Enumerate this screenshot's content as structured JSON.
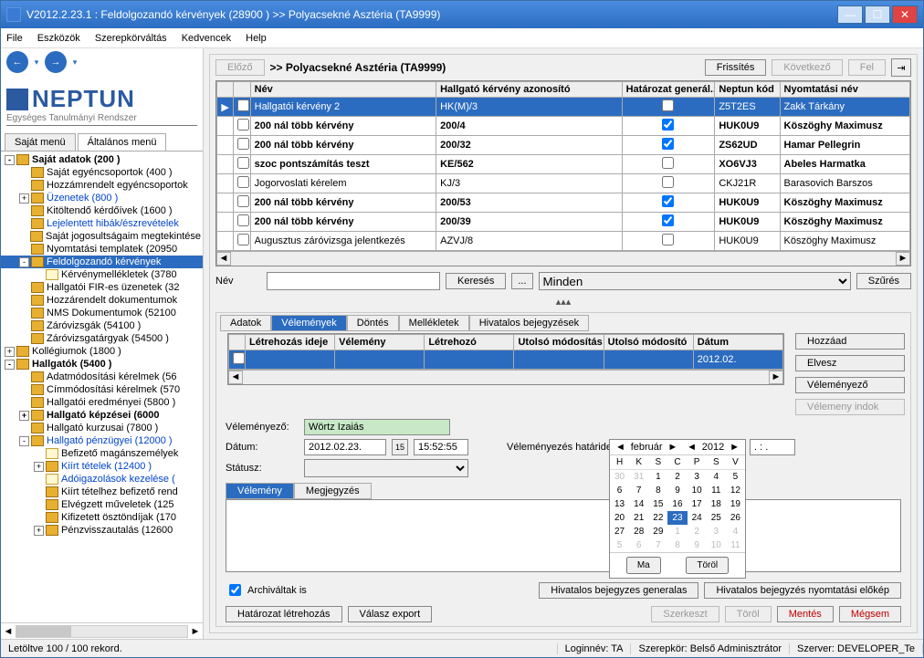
{
  "window": {
    "title": "V2012.2.23.1 : Feldolgozandó kérvények (28900 )  >> Polyacsekné Asztéria (TA9999)"
  },
  "menu": [
    "File",
    "Eszközök",
    "Szerepkörváltás",
    "Kedvencek",
    "Help"
  ],
  "logo": {
    "text": "NEPTUN",
    "sub": "Egységes Tanulmányi Rendszer"
  },
  "sidebarTabs": {
    "a": "Saját menü",
    "b": "Általános menü"
  },
  "tree": [
    {
      "lvl": 0,
      "exp": "-",
      "icon": "f",
      "bold": true,
      "label": "Saját adatok (200  )"
    },
    {
      "lvl": 1,
      "exp": "",
      "icon": "f",
      "label": "Saját egyéncsoportok (400  )"
    },
    {
      "lvl": 1,
      "exp": "",
      "icon": "f",
      "label": "Hozzámrendelt egyéncsoportok"
    },
    {
      "lvl": 1,
      "exp": "+",
      "icon": "f",
      "link": true,
      "label": "Üzenetek (800  )"
    },
    {
      "lvl": 1,
      "exp": "",
      "icon": "f",
      "label": "Kitöltendő kérdőívek (1600  )"
    },
    {
      "lvl": 1,
      "exp": "",
      "icon": "f",
      "link": true,
      "label": "Lejelentett hibák/észrevételek"
    },
    {
      "lvl": 1,
      "exp": "",
      "icon": "f",
      "label": "Saját jogosultságaim megtekintése"
    },
    {
      "lvl": 1,
      "exp": "",
      "icon": "f",
      "label": "Nyomtatási templatek (20950"
    },
    {
      "lvl": 1,
      "exp": "-",
      "icon": "f",
      "link": true,
      "sel": true,
      "label": "Feldolgozandó kérvények"
    },
    {
      "lvl": 2,
      "exp": "",
      "icon": "d",
      "label": "Kérvénymellékletek (3780"
    },
    {
      "lvl": 1,
      "exp": "",
      "icon": "f",
      "label": "Hallgatói FIR-es üzenetek (32"
    },
    {
      "lvl": 1,
      "exp": "",
      "icon": "f",
      "label": "Hozzárendelt dokumentumok"
    },
    {
      "lvl": 1,
      "exp": "",
      "icon": "f",
      "label": "NMS Dokumentumok (52100"
    },
    {
      "lvl": 1,
      "exp": "",
      "icon": "f",
      "label": "Záróvizsgák (54100  )"
    },
    {
      "lvl": 1,
      "exp": "",
      "icon": "f",
      "label": "Záróvizsgatárgyak (54500  )"
    },
    {
      "lvl": 0,
      "exp": "+",
      "icon": "f",
      "label": "Kollégiumok (1800  )"
    },
    {
      "lvl": 0,
      "exp": "-",
      "icon": "f",
      "bold": true,
      "label": "Hallgatók (5400  )"
    },
    {
      "lvl": 1,
      "exp": "",
      "icon": "f",
      "label": "Adatmódosítási kérelmek (56"
    },
    {
      "lvl": 1,
      "exp": "",
      "icon": "f",
      "label": "Címmódosítási kérelmek (570"
    },
    {
      "lvl": 1,
      "exp": "",
      "icon": "f",
      "label": "Hallgatói eredményei (5800  )"
    },
    {
      "lvl": 1,
      "exp": "+",
      "icon": "f",
      "bold": true,
      "label": "Hallgató képzései (6000"
    },
    {
      "lvl": 1,
      "exp": "",
      "icon": "f",
      "label": "Hallgató kurzusai (7800  )"
    },
    {
      "lvl": 1,
      "exp": "-",
      "icon": "f",
      "link": true,
      "label": "Hallgató pénzügyei (12000  )"
    },
    {
      "lvl": 2,
      "exp": "",
      "icon": "d",
      "label": "Befizető magánszemélyek"
    },
    {
      "lvl": 2,
      "exp": "+",
      "icon": "f",
      "link": true,
      "label": "Kiírt tételek (12400  )"
    },
    {
      "lvl": 2,
      "exp": "",
      "icon": "d",
      "link": true,
      "label": "Adóigazolások kezelése ("
    },
    {
      "lvl": 2,
      "exp": "",
      "icon": "f",
      "label": "Kiírt tételhez befizető rend"
    },
    {
      "lvl": 2,
      "exp": "",
      "icon": "f",
      "label": "Elvégzett műveletek (125"
    },
    {
      "lvl": 2,
      "exp": "",
      "icon": "f",
      "label": "Kifizetett ösztöndíjak (170"
    },
    {
      "lvl": 2,
      "exp": "+",
      "icon": "f",
      "label": "Pénzvisszautalás (12600"
    }
  ],
  "header": {
    "prev": "Előző",
    "title": ">> Polyacsekné Asztéria (TA9999)",
    "refresh": "Frissítés",
    "next": "Következő",
    "up": "Fel"
  },
  "grid": {
    "cols": [
      "Név",
      "Hallgató kérvény azonosító",
      "Határozat generál...",
      "Neptun kód",
      "Nyomtatási név"
    ],
    "rows": [
      {
        "sel": true,
        "bold": false,
        "name": "Hallgatói kérvény 2",
        "id": "HK(M)/3",
        "chk": false,
        "code": "Z5T2ES",
        "pname": "Zakk Tárkány"
      },
      {
        "bold": true,
        "name": "200 nál több kérvény",
        "id": "200/4",
        "chk": true,
        "code": "HUK0U9",
        "pname": "Köszöghy Maximusz"
      },
      {
        "bold": true,
        "name": "200 nál több kérvény",
        "id": "200/32",
        "chk": true,
        "code": "ZS62UD",
        "pname": "Hamar Pellegrin"
      },
      {
        "bold": true,
        "name": "szoc pontszámítás teszt",
        "id": "KE/562",
        "chk": false,
        "code": "XO6VJ3",
        "pname": "Abeles Harmatka"
      },
      {
        "bold": false,
        "name": "Jogorvoslati kérelem",
        "id": "KJ/3",
        "chk": false,
        "code": "CKJ21R",
        "pname": "Barasovich Barszos"
      },
      {
        "bold": true,
        "name": "200 nál több kérvény",
        "id": "200/53",
        "chk": true,
        "code": "HUK0U9",
        "pname": "Köszöghy Maximusz"
      },
      {
        "bold": true,
        "name": "200 nál több kérvény",
        "id": "200/39",
        "chk": true,
        "code": "HUK0U9",
        "pname": "Köszöghy Maximusz"
      },
      {
        "bold": false,
        "name": "Augusztus záróvizsga jelentkezés",
        "id": "AZVJ/8",
        "chk": false,
        "code": "HUK0U9",
        "pname": "Köszöghy Maximusz"
      }
    ]
  },
  "search": {
    "label": "Név",
    "btn": "Keresés",
    "dots": "...",
    "all": "Minden",
    "filter": "Szűrés"
  },
  "sub": {
    "tabs": [
      "Adatok",
      "Vélemények",
      "Döntés",
      "Mellékletek",
      "Hivatalos bejegyzések"
    ],
    "active": 1,
    "cols": [
      "Létrehozás ideje",
      "Vélemény",
      "Létrehozó",
      "Utolsó módosítás ...",
      "Utolsó módosító",
      "Dátum"
    ],
    "rowDate": "2012.02.",
    "sidebtns": [
      "Hozzáad",
      "Elvesz",
      "Véleményező",
      "Vélemeny indok"
    ],
    "fields": {
      "reviewerLbl": "Véleményező:",
      "reviewer": "Wörtz Izaiás",
      "dateLbl": "Dátum:",
      "date": "2012.02.23.",
      "time": "15:52:55",
      "deadlineLbl": "Véleményezés határideje:",
      "deadline": "2012.02.23.",
      "deadlineTime": ". : .",
      "statusLbl": "Státusz:"
    },
    "innerTabs": [
      "Vélemény",
      "Megjegyzés"
    ]
  },
  "calendar": {
    "month": "február",
    "year": "2012",
    "dh": [
      "H",
      "K",
      "S",
      "C",
      "P",
      "S",
      "V"
    ],
    "days": [
      {
        "d": "30",
        "o": 1
      },
      {
        "d": "31",
        "o": 1
      },
      {
        "d": "1"
      },
      {
        "d": "2"
      },
      {
        "d": "3"
      },
      {
        "d": "4"
      },
      {
        "d": "5"
      },
      {
        "d": "6"
      },
      {
        "d": "7"
      },
      {
        "d": "8"
      },
      {
        "d": "9"
      },
      {
        "d": "10"
      },
      {
        "d": "11"
      },
      {
        "d": "12"
      },
      {
        "d": "13"
      },
      {
        "d": "14"
      },
      {
        "d": "15"
      },
      {
        "d": "16"
      },
      {
        "d": "17"
      },
      {
        "d": "18"
      },
      {
        "d": "19"
      },
      {
        "d": "20"
      },
      {
        "d": "21"
      },
      {
        "d": "22"
      },
      {
        "d": "23",
        "s": 1
      },
      {
        "d": "24"
      },
      {
        "d": "25"
      },
      {
        "d": "26"
      },
      {
        "d": "27"
      },
      {
        "d": "28"
      },
      {
        "d": "29"
      },
      {
        "d": "1",
        "o": 1
      },
      {
        "d": "2",
        "o": 1
      },
      {
        "d": "3",
        "o": 1
      },
      {
        "d": "4",
        "o": 1
      },
      {
        "d": "5",
        "o": 1
      },
      {
        "d": "6",
        "o": 1
      },
      {
        "d": "7",
        "o": 1
      },
      {
        "d": "8",
        "o": 1
      },
      {
        "d": "9",
        "o": 1
      },
      {
        "d": "10",
        "o": 1
      },
      {
        "d": "11",
        "o": 1
      }
    ],
    "today": "Ma",
    "clear": "Töröl"
  },
  "bottom": {
    "archive": "Archiváltak is",
    "b1": "Határozat létrehozás",
    "b2": "Válasz export",
    "b3": "Hivatalos bejegyzes generalas",
    "b4": "Hivatalos bejegyzés nyomtatási előkép",
    "b5": "Szerkeszt",
    "b6": "Töröl",
    "b7": "Mentés",
    "b8": "Mégsem"
  },
  "status": {
    "left": "Letöltve 100 / 100 rekord.",
    "login": "Loginnév: TA",
    "role": "Szerepkör: Belső Adminisztrátor",
    "server": "Szerver: DEVELOPER_Te"
  }
}
